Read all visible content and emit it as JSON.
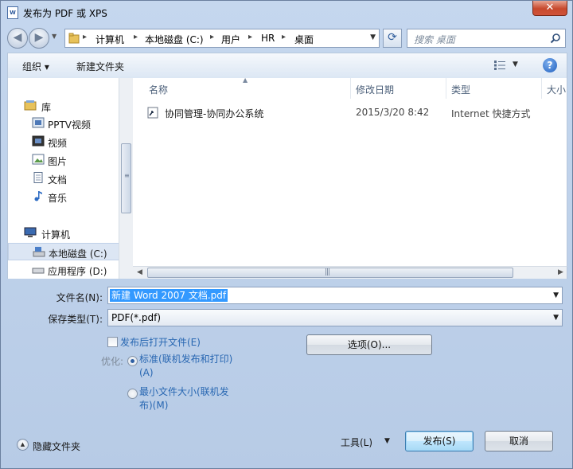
{
  "window": {
    "title": "发布为 PDF 或 XPS",
    "title_icon_text": "W",
    "close_glyph": "✕"
  },
  "address": {
    "back_glyph": "◀",
    "forward_glyph": "▶",
    "breadcrumbs": [
      "计算机",
      "本地磁盘 (C:)",
      "用户",
      "HR",
      "桌面"
    ],
    "separator": "▸",
    "refresh_glyph": "⟳"
  },
  "search": {
    "placeholder": "搜索 桌面"
  },
  "toolbar": {
    "organize_label": "组织 ▾",
    "new_folder_label": "新建文件夹",
    "help_glyph": "?"
  },
  "nav": {
    "items": [
      {
        "label": "库",
        "icon": "library-icon"
      },
      {
        "label": "PPTV视频",
        "icon": "video-library-icon"
      },
      {
        "label": "视频",
        "icon": "video-library-icon"
      },
      {
        "label": "图片",
        "icon": "pictures-icon"
      },
      {
        "label": "文档",
        "icon": "documents-icon"
      },
      {
        "label": "音乐",
        "icon": "music-icon"
      },
      {
        "label": "计算机",
        "icon": "computer-icon"
      },
      {
        "label": "本地磁盘 (C:)",
        "icon": "drive-c-icon"
      },
      {
        "label": "应用程序 (D:)",
        "icon": "drive-d-icon"
      }
    ]
  },
  "files": {
    "columns": [
      "名称",
      "修改日期",
      "类型",
      "大小"
    ],
    "rows": [
      {
        "name": "协同管理-协同办公系统",
        "date": "2015/3/20 8:42",
        "type": "Internet 快捷方式",
        "icon": "internet-shortcut-icon"
      }
    ]
  },
  "form": {
    "filename_label": "文件名(N):",
    "filename_value": "新建 Word 2007 文档.pdf",
    "filetype_label": "保存类型(T):",
    "filetype_value": "PDF(*.pdf)",
    "open_after_label": "发布后打开文件(E)",
    "open_after_checked": false,
    "optimize_label": "优化:",
    "optimize_options": [
      {
        "line1": "标准(联机发布和打印)",
        "line2": "(A)",
        "selected": true
      },
      {
        "line1": "最小文件大小(联机发",
        "line2": "布)(M)",
        "selected": false
      }
    ],
    "options_button": "选项(O)..."
  },
  "footer": {
    "toggle_glyph": "▲",
    "hide_folders_label": "隐藏文件夹",
    "tools_label": "工具(L)",
    "tools_drop_glyph": "▼",
    "publish_button": "发布(S)",
    "cancel_button": "取消"
  }
}
